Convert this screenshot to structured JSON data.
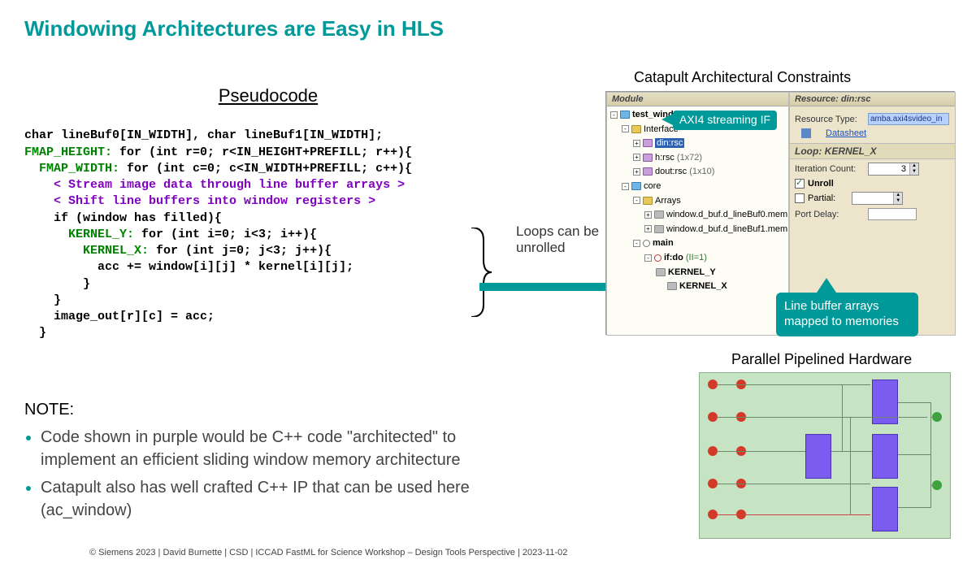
{
  "title": "Windowing Architectures are Easy in HLS",
  "pseudocode_header": "Pseudocode",
  "code": {
    "l1": "char lineBuf0[IN_WIDTH], char lineBuf1[IN_WIDTH];",
    "l2a": "FMAP_HEIGHT:",
    "l2b": " for (int r=0; r<IN_HEIGHT+PREFILL; r++){",
    "l3a": "  FMAP_WIDTH:",
    "l3b": " for (int c=0; c<IN_WIDTH+PREFILL; c++){",
    "l4": "    < Stream image data through line buffer arrays >",
    "l5": "    < Shift line buffers into window registers >",
    "l6": "    if (window has filled){",
    "l7a": "      KERNEL_Y:",
    "l7b": " for (int i=0; i<3; i++){",
    "l8a": "        KERNEL_X:",
    "l8b": " for (int j=0; j<3; j++){",
    "l9": "          acc += window[i][j] * kernel[i][j];",
    "l10": "        }",
    "l11": "    }",
    "l12": "    image_out[r][c] = acc;",
    "l13": "  }"
  },
  "annotations": {
    "loops": "Loops can be unrolled",
    "axi": "AXI4 streaming IF",
    "linebuf": "Line buffer arrays mapped to memories"
  },
  "note": {
    "header": "NOTE:",
    "b1": "Code shown in purple would be C++ code \"architected\" to implement an efficient sliding window memory architecture",
    "b2": "Catapult also has well crafted C++ IP that can be used here (ac_window)"
  },
  "catapult": {
    "title": "Catapult Architectural Constraints",
    "module_hdr": "Module",
    "resource_hdr": "Resource: din:rsc",
    "tree": {
      "root": "test_window",
      "iface": "Interface",
      "din": "din:rsc",
      "h": "h:rsc",
      "h_dim": "(1x72)",
      "dout": "dout:rsc",
      "dout_dim": "(1x10)",
      "core": "core",
      "arrays": "Arrays",
      "a1": "window.d_buf.d_lineBuf0.mem",
      "a2": "window.d_buf.d_lineBuf1.mem",
      "main": "main",
      "ifdo": "if:do",
      "ifdo_info": "(II=1)",
      "ky": "KERNEL_Y",
      "kx": "KERNEL_X"
    },
    "res": {
      "type_label": "Resource Type:",
      "type_val": "amba.axi4svideo_in",
      "datasheet": "Datasheet",
      "loop_hdr": "Loop: KERNEL_X",
      "iter_label": "Iteration Count:",
      "iter_val": "3",
      "unroll": "Unroll",
      "partial": "Partial:",
      "portdelay": "Port Delay:"
    }
  },
  "hardware_title": "Parallel Pipelined Hardware",
  "footer": "© Siemens 2023 | David Burnette | CSD | ICCAD FastML for Science Workshop – Design Tools Perspective | 2023-11-02"
}
